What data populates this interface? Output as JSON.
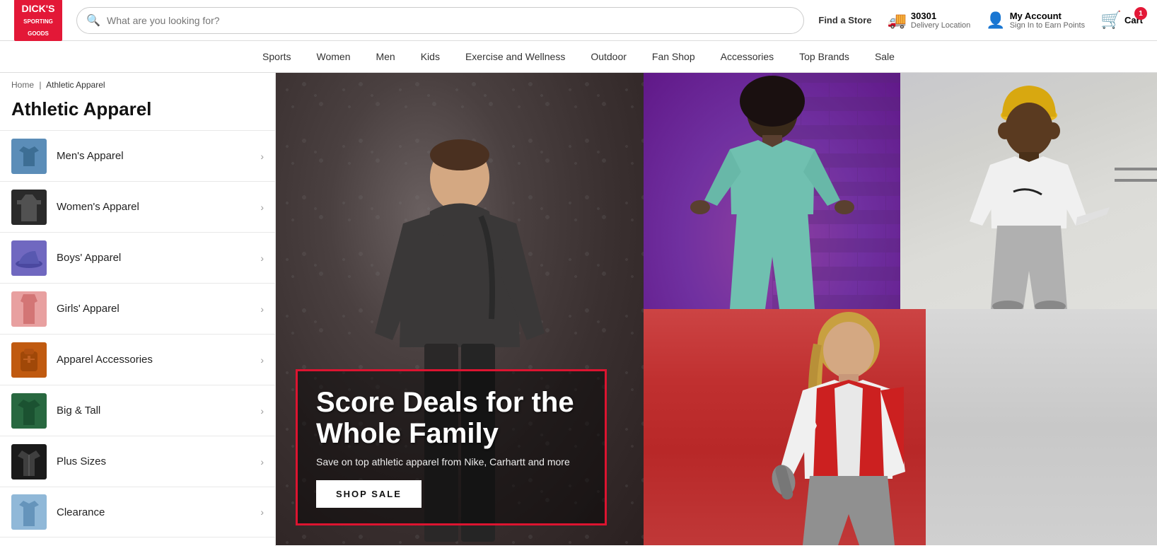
{
  "header": {
    "logo_line1": "DICK'S",
    "logo_line2": "SPORTING",
    "logo_line3": "GOODS",
    "search_placeholder": "What are you looking for?",
    "find_store_label": "Find a Store",
    "delivery_label": "30301",
    "delivery_sub": "Delivery Location",
    "account_label": "My Account",
    "account_sub": "Sign In to Earn Points",
    "cart_label": "Cart",
    "cart_count": "1"
  },
  "nav": {
    "items": [
      {
        "id": "sports",
        "label": "Sports"
      },
      {
        "id": "women",
        "label": "Women"
      },
      {
        "id": "men",
        "label": "Men"
      },
      {
        "id": "kids",
        "label": "Kids"
      },
      {
        "id": "exercise",
        "label": "Exercise and Wellness"
      },
      {
        "id": "outdoor",
        "label": "Outdoor"
      },
      {
        "id": "fanshop",
        "label": "Fan Shop"
      },
      {
        "id": "accessories",
        "label": "Accessories"
      },
      {
        "id": "topbrands",
        "label": "Top Brands"
      },
      {
        "id": "sale",
        "label": "Sale"
      }
    ]
  },
  "breadcrumb": {
    "home": "Home",
    "current": "Athletic Apparel"
  },
  "page_title": "Athletic Apparel",
  "sidebar": {
    "items": [
      {
        "id": "mens",
        "label": "Men's Apparel",
        "thumb_color": "#5b8db8"
      },
      {
        "id": "womens",
        "label": "Women's Apparel",
        "thumb_color": "#222222"
      },
      {
        "id": "boys",
        "label": "Boys' Apparel",
        "thumb_color": "#7068c0"
      },
      {
        "id": "girls",
        "label": "Girls' Apparel",
        "thumb_color": "#d88888"
      },
      {
        "id": "accessories",
        "label": "Apparel Accessories",
        "thumb_color": "#c05a10"
      },
      {
        "id": "bigtall",
        "label": "Big & Tall",
        "thumb_color": "#286840"
      },
      {
        "id": "plus",
        "label": "Plus Sizes",
        "thumb_color": "#1a1a1a"
      },
      {
        "id": "clearance",
        "label": "Clearance",
        "thumb_color": "#90b8d8"
      }
    ]
  },
  "promo": {
    "headline": "Score Deals for the Whole Family",
    "subtext": "Save on top athletic apparel from Nike, Carhartt and more",
    "cta_label": "SHOP SALE"
  }
}
